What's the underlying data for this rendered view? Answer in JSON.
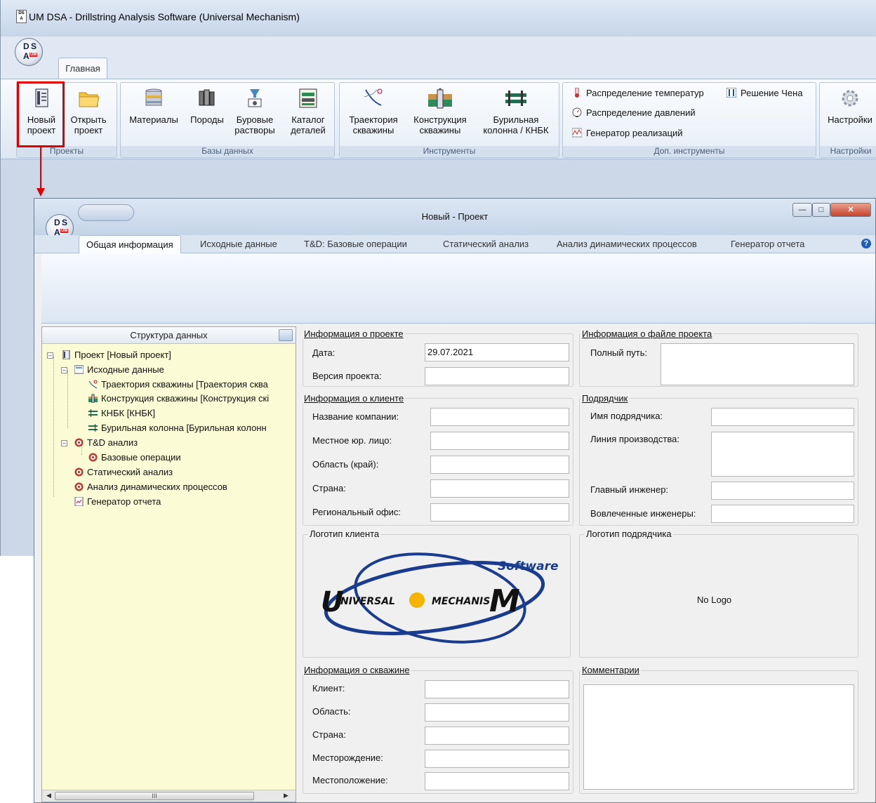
{
  "main_window": {
    "title": "UM DSA - Drillstring Analysis Software (Universal Mechanism)",
    "orb_letters": [
      "D",
      "S",
      "A",
      "UM"
    ],
    "ribbon_tab": "Главная",
    "groups": {
      "projects": {
        "caption": "Проекты",
        "buttons": [
          {
            "line1": "Новый",
            "line2": "проект",
            "icon": "new-project-icon"
          },
          {
            "line1": "Открыть",
            "line2": "проект",
            "icon": "open-folder-icon"
          }
        ]
      },
      "databases": {
        "caption": "Базы данных",
        "buttons": [
          {
            "line1": "Материалы",
            "line2": "",
            "icon": "database-icon"
          },
          {
            "line1": "Породы",
            "line2": "",
            "icon": "rocks-icon"
          },
          {
            "line1": "Буровые",
            "line2": "растворы",
            "icon": "fluid-icon"
          },
          {
            "line1": "Каталог",
            "line2": "деталей",
            "icon": "catalog-icon"
          }
        ]
      },
      "tools": {
        "caption": "Инструменты",
        "buttons": [
          {
            "line1": "Траектория",
            "line2": "скважины",
            "icon": "trajectory-icon"
          },
          {
            "line1": "Конструкция",
            "line2": "скважины",
            "icon": "well-construction-icon"
          },
          {
            "line1": "Бурильная",
            "line2": "колонна / КНБК",
            "icon": "drillstring-icon"
          }
        ]
      },
      "extra_tools": {
        "caption": "Доп. инструменты",
        "items": [
          {
            "label": "Распределение температур",
            "icon": "thermometer-icon"
          },
          {
            "label": "Решение Чена",
            "icon": "chen-solution-icon"
          },
          {
            "label": "Распределение давлений",
            "icon": "pressure-gauge-icon"
          },
          {
            "label": "Генератор реализаций",
            "icon": "realization-generator-icon"
          }
        ]
      },
      "settings": {
        "caption": "Настройки",
        "button": {
          "label": "Настройки",
          "icon": "gear-icon"
        }
      }
    }
  },
  "project_window": {
    "title": "Новый - Проект",
    "tabs": [
      "Общая информация",
      "Исходные данные",
      "T&D: Базовые операции",
      "Статический анализ",
      "Анализ динамических процессов",
      "Генератор отчета"
    ],
    "active_tab": "Общая информация",
    "help": "?",
    "tree": {
      "header": "Структура данных",
      "items": [
        "Проект [Новый проект]",
        "Исходные данные",
        "Траектория скважины [Траектория сква",
        "Конструкция скважины [Конструкция скі",
        "КНБК [КНБК]",
        "Бурильная колонна [Бурильная колонн",
        "T&D анализ",
        "Базовые операции",
        "Статический анализ",
        "Анализ динамических процессов",
        "Генератор отчета"
      ],
      "scroll_thumb": "III"
    },
    "project_info": {
      "legend": "Информация о проекте",
      "date_label": "Дата:",
      "date_value": "29.07.2021",
      "version_label": "Версия проекта:",
      "version_value": ""
    },
    "file_info": {
      "legend": "Информация о файле проекта",
      "path_label": "Полный путь:",
      "path_value": ""
    },
    "client_info": {
      "legend": "Информация о клиенте",
      "fields": [
        {
          "label": "Название компании:",
          "value": ""
        },
        {
          "label": "Местное юр. лицо:",
          "value": ""
        },
        {
          "label": "Область (край):",
          "value": ""
        },
        {
          "label": "Страна:",
          "value": ""
        },
        {
          "label": "Региональный офис:",
          "value": ""
        }
      ]
    },
    "contractor": {
      "legend": "Подрядчик",
      "fields": [
        {
          "label": "Имя подрядчика:",
          "value": ""
        },
        {
          "label": "Линия производства:",
          "value": ""
        },
        {
          "label": "Главный инженер:",
          "value": ""
        },
        {
          "label": "Вовлеченные инженеры:",
          "value": ""
        }
      ]
    },
    "client_logo": {
      "legend": "Логотип клиента",
      "logo_words": [
        "Software",
        "U",
        "NIVERSAL",
        "MECHANIS",
        "M"
      ]
    },
    "contractor_logo": {
      "legend": "Логотип подрядчика",
      "placeholder": "No Logo"
    },
    "well_info": {
      "legend": "Информация о скважине",
      "fields": [
        {
          "label": "Клиент:",
          "value": ""
        },
        {
          "label": "Область:",
          "value": ""
        },
        {
          "label": "Страна:",
          "value": ""
        },
        {
          "label": "Месторождение:",
          "value": ""
        },
        {
          "label": "Местоположение:",
          "value": ""
        }
      ]
    },
    "comments": {
      "legend": "Комментарии",
      "value": ""
    }
  },
  "colors": {
    "highlight": "#e00000",
    "tree_background": "#fbfbd6",
    "window_frame": "#c4d4e8"
  }
}
